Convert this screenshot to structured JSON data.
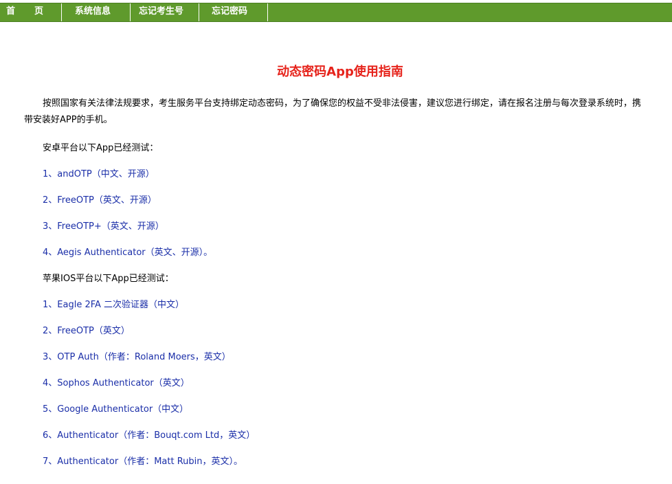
{
  "nav": {
    "home_1": "首",
    "home_2": "页",
    "sys_info": "系统信息",
    "forgot_id": "忘记考生号",
    "forgot_pwd": "忘记密码"
  },
  "title": "动态密码App使用指南",
  "intro": "按照国家有关法律法规要求，考生服务平台支持绑定动态密码，为了确保您的权益不受非法侵害，建议您进行绑定，请在报名注册与每次登录系统时，携带安装好APP的手机。",
  "android": {
    "heading": "安卓平台以下App已经测试：",
    "items": [
      "1、andOTP（中文、开源）",
      "2、FreeOTP（英文、开源）",
      "3、FreeOTP+（英文、开源）",
      "4、Aegis Authenticator（英文、开源）。"
    ]
  },
  "ios": {
    "heading": "苹果IOS平台以下App已经测试：",
    "items": [
      "1、Eagle 2FA 二次验证器（中文）",
      "2、FreeOTP（英文）",
      "3、OTP Auth（作者：Roland Moers，英文）",
      "4、Sophos Authenticator（英文）",
      "5、Google Authenticator（中文）",
      "6、Authenticator（作者：Bouqt.com Ltd，英文）",
      "7、Authenticator（作者：Matt Rubin，英文）。"
    ]
  },
  "colors": {
    "nav_bg": "#5f9a2c",
    "title": "#e6231b",
    "link_text": "#1a2ea8"
  }
}
